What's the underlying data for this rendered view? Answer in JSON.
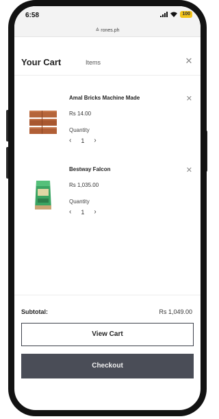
{
  "status_bar": {
    "time": "6:58",
    "battery": "100"
  },
  "browser": {
    "url": "≙ rones.ph"
  },
  "cart": {
    "title": "Your Cart",
    "count_label": "Items",
    "items": [
      {
        "name": "Amal Bricks Machine Made",
        "price": "Rs 14.00",
        "quantity_label": "Quantity",
        "quantity": "1",
        "icon": "bricks-image"
      },
      {
        "name": "Bestway Falcon",
        "price": "Rs 1,035.00",
        "quantity_label": "Quantity",
        "quantity": "1",
        "icon": "cement-bag-image"
      }
    ],
    "subtotal_label": "Subtotal:",
    "subtotal_value": "Rs 1,049.00",
    "view_cart_label": "View Cart",
    "checkout_label": "Checkout"
  },
  "colors": {
    "checkout_bg": "#4a4d57",
    "battery": "#f2c318",
    "frame": "#121212"
  }
}
